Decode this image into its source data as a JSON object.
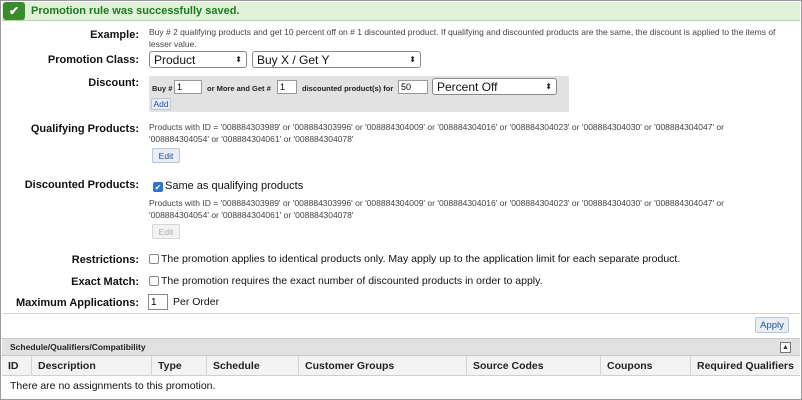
{
  "banner": {
    "message": "Promotion rule was successfully saved."
  },
  "example": {
    "label": "Example:",
    "text": "Buy # 2 qualifying products and get 10 percent off on # 1 discounted product. If qualifying and discounted products are the same, the discount is applied to the items of lesser value."
  },
  "promotion_class": {
    "label": "Promotion Class:",
    "class_value": "Product",
    "type_value": "Buy X / Get Y"
  },
  "discount": {
    "label": "Discount:",
    "buy_label": "Buy #",
    "buy_value": "1",
    "more_label": "or More and Get #",
    "get_value": "1",
    "discounted_label": "discounted product(s) for",
    "amount_value": "50",
    "mode_value": "Percent Off",
    "add_label": "Add"
  },
  "qualifying": {
    "label": "Qualifying Products:",
    "line1": "Products with ID = '008884303989' or '008884303996' or '008884304009' or '008884304016' or '008884304023' or '008884304030' or '008884304047' or",
    "line2": "'008884304054' or '008884304061' or '008884304078'",
    "edit_label": "Edit"
  },
  "discounted": {
    "label": "Discounted Products:",
    "same_label": "Same as qualifying products",
    "same_checked": true,
    "line1": "Products with ID = '008884303989' or '008884303996' or '008884304009' or '008884304016' or '008884304023' or '008884304030' or '008884304047' or",
    "line2": "'008884304054' or '008884304061' or '008884304078'",
    "edit_label": "Edit"
  },
  "restrictions": {
    "label": "Restrictions:",
    "text": "The promotion applies to identical products only. May apply up to the application limit for each separate product."
  },
  "exact_match": {
    "label": "Exact Match:",
    "text": "The promotion requires the exact number of discounted products in order to apply."
  },
  "max_apps": {
    "label": "Maximum Applications:",
    "value": "1",
    "suffix": "Per Order"
  },
  "apply_label": "Apply",
  "section": {
    "title": "Schedule/Qualifiers/Compatibility",
    "columns": [
      "ID",
      "Description",
      "Type",
      "Schedule",
      "Customer Groups",
      "Source Codes",
      "Coupons",
      "Required Qualifiers"
    ],
    "empty_text": "There are no assignments to this promotion."
  },
  "colors": {
    "success_bg": "#dff2d8",
    "success_text": "#1d7a1d",
    "checkbox_on": "#2f74d0",
    "button_text": "#1c4f9c"
  }
}
